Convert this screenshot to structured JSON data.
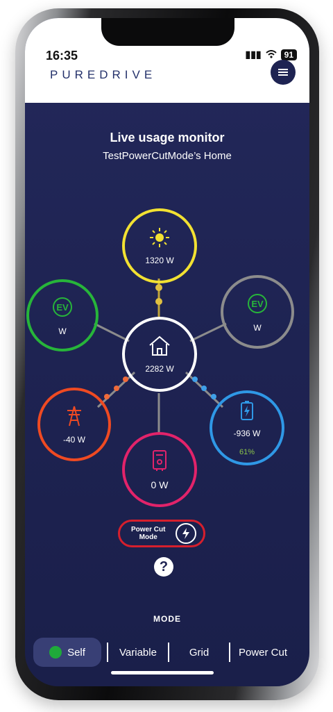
{
  "status_bar": {
    "time": "16:35",
    "battery": "91"
  },
  "header": {
    "brand": "PUREDRIVE"
  },
  "page": {
    "title": "Live usage monitor",
    "subtitle": "TestPowerCutMode’s Home"
  },
  "nodes": {
    "solar": {
      "label": "1320 W",
      "color": "#f2e132"
    },
    "ev_left": {
      "label": "W",
      "color": "#27b53a"
    },
    "ev_right": {
      "label": "W",
      "color": "#8c8c8c"
    },
    "home": {
      "label": "2282 W",
      "color": "#ffffff"
    },
    "grid": {
      "label": "-40 W",
      "color": "#ef4a22"
    },
    "battery": {
      "label": "-936 W",
      "percent": "61%",
      "color": "#2f98e6"
    },
    "hot_water": {
      "label": "0 W",
      "color": "#e2236a"
    }
  },
  "power_cut": {
    "label_line1": "Power Cut",
    "label_line2": "Mode"
  },
  "help": {
    "label": "?"
  },
  "mode": {
    "label": "MODE",
    "tabs": [
      "Self",
      "Variable",
      "Grid",
      "Power Cut"
    ]
  }
}
